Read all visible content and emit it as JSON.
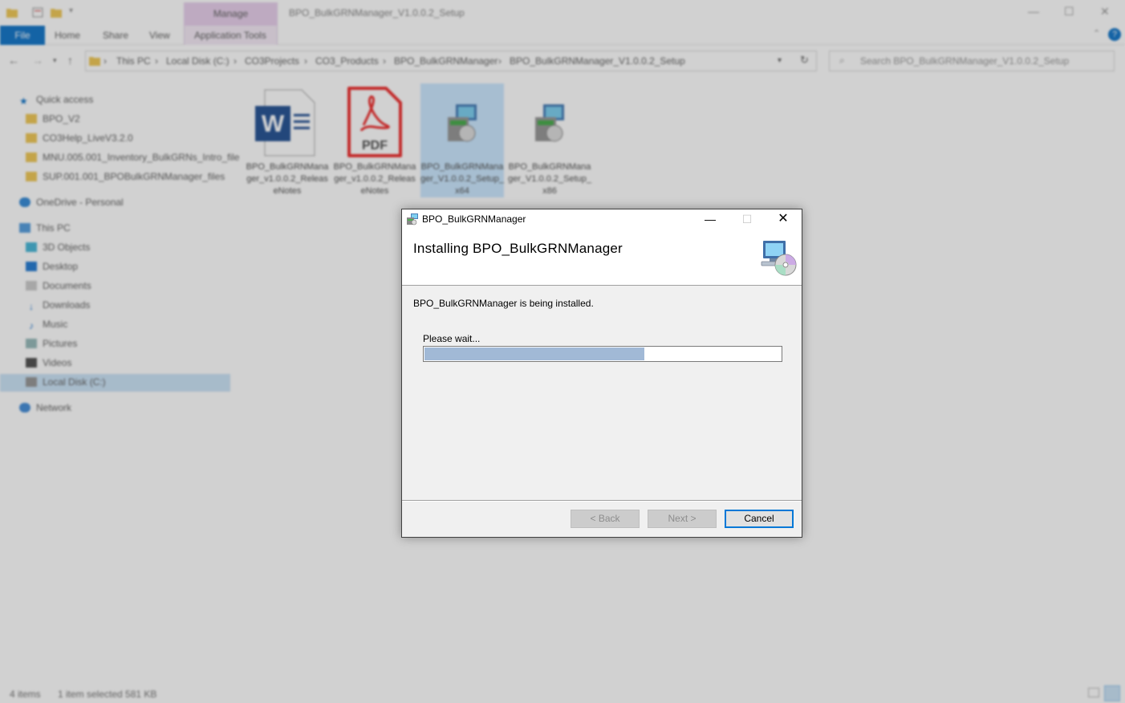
{
  "explorer": {
    "title": "BPO_BulkGRNManager_V1.0.0.2_Setup",
    "manage_tab": "Manage",
    "ribbon": {
      "file": "File",
      "home": "Home",
      "share": "Share",
      "view": "View",
      "application_tools": "Application Tools"
    },
    "breadcrumb": [
      "This PC",
      "Local Disk (C:)",
      "CO3Projects",
      "CO3_Products",
      "BPO_BulkGRNManager",
      "BPO_BulkGRNManager_V1.0.0.2_Setup"
    ],
    "search_placeholder": "Search BPO_BulkGRNManager_V1.0.0.2_Setup",
    "nav": {
      "quick_access": "Quick access",
      "quick_items": [
        "BPO_V2",
        "CO3Help_LiveV3.2.0",
        "MNU.005.001_Inventory_BulkGRNs_Intro_file",
        "SUP.001.001_BPOBulkGRNManager_files"
      ],
      "onedrive": "OneDrive - Personal",
      "this_pc": "This PC",
      "pc_items": [
        "3D Objects",
        "Desktop",
        "Documents",
        "Downloads",
        "Music",
        "Pictures",
        "Videos",
        "Local Disk (C:)"
      ],
      "network": "Network"
    },
    "files": [
      {
        "name": "BPO_BulkGRNManager_v1.0.0.2_ReleaseNotes",
        "icon": "word-doc-icon"
      },
      {
        "name": "BPO_BulkGRNManager_v1.0.0.2_ReleaseNotes",
        "icon": "pdf-icon"
      },
      {
        "name": "BPO_BulkGRNManager_V1.0.0.2_Setup_x64",
        "icon": "installer-icon"
      },
      {
        "name": "BPO_BulkGRNManager_V1.0.0.2_Setup_x86",
        "icon": "installer-icon"
      }
    ],
    "status": {
      "items": "4 items",
      "selected": "1 item selected  581 KB"
    }
  },
  "dialog": {
    "title": "BPO_BulkGRNManager",
    "heading": "Installing BPO_BulkGRNManager",
    "status_text": "BPO_BulkGRNManager is being installed.",
    "wait_text": "Please wait...",
    "progress_fraction": 0.616,
    "buttons": {
      "back": "< Back",
      "next": "Next >",
      "cancel": "Cancel"
    },
    "colors": {
      "progress_fill": "#a1b9d6",
      "accent": "#0078d7"
    }
  }
}
